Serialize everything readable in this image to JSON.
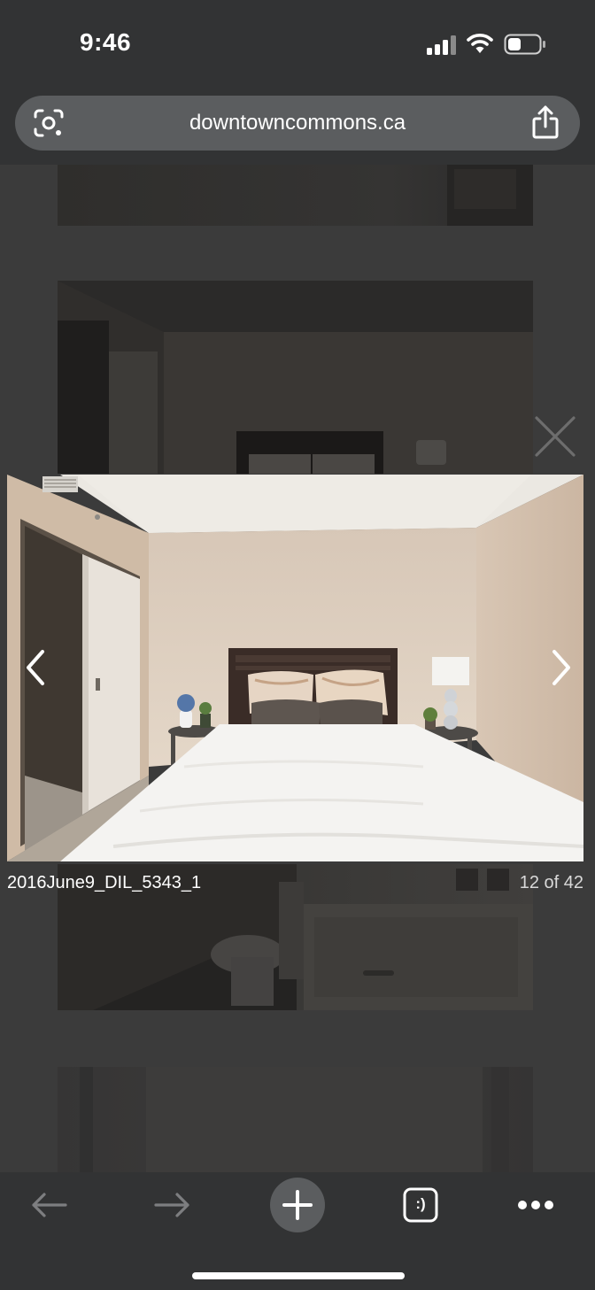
{
  "status": {
    "time": "9:46"
  },
  "browser": {
    "url": "downtowncommons.ca"
  },
  "lightbox": {
    "caption": "2016June9_DIL_5343_1",
    "counter": "12 of 42"
  },
  "toolbar": {
    "tab_icon_label": ":)"
  },
  "colors": {
    "chrome": "#323334",
    "urlbar": "#5b5d5f",
    "overlay": "#3b3b3b"
  }
}
